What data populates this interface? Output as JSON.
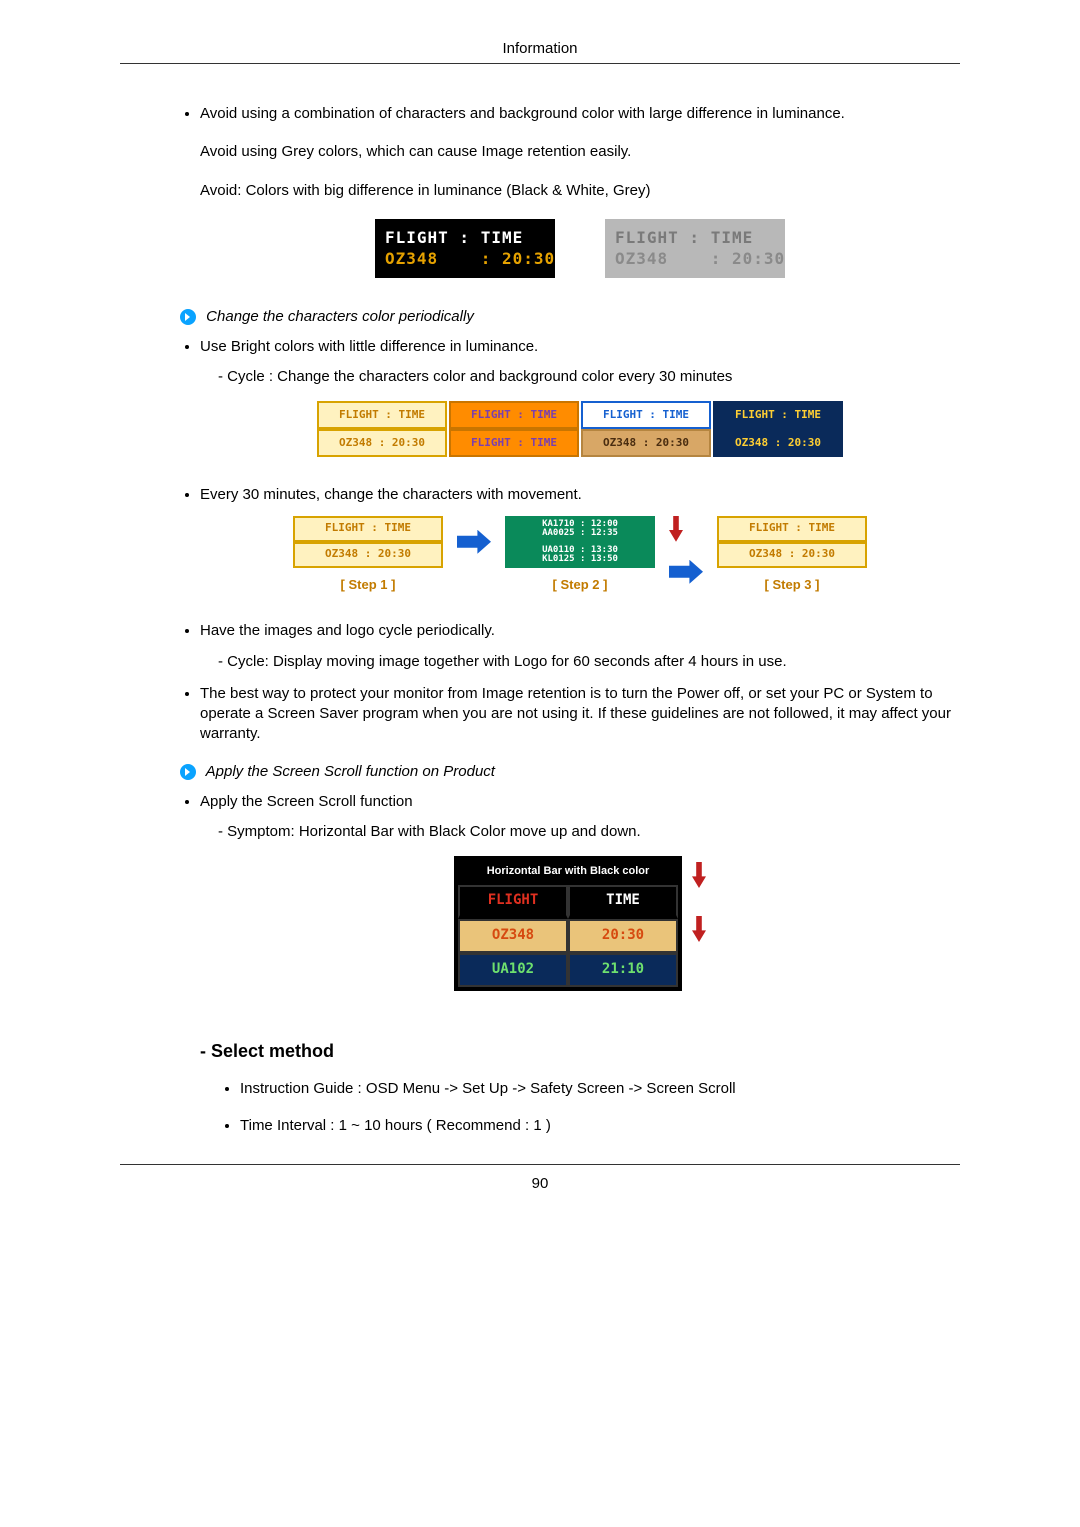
{
  "header": {
    "title": "Information"
  },
  "body": {
    "p1": "Avoid using a combination of characters and background color with large difference in luminance.",
    "p2": "Avoid using Grey colors, which can cause Image retention easily.",
    "p3": "Avoid: Colors with big difference in luminance (Black & White, Grey)",
    "flight_sample": {
      "row1": "FLIGHT : TIME",
      "row2": "OZ348    : 20:30"
    },
    "sec1_title": "Change the characters color periodically",
    "li_bright": "Use Bright colors with little difference in luminance.",
    "li_bright_sub": "- Cycle : Change the characters color and background color every 30 minutes",
    "cycle_cells": {
      "a": "FLIGHT : TIME",
      "b": "OZ348    : 20:30",
      "c": "FLIGHT : TIME",
      "d": "FLIGHT : TIME",
      "e": "OZ348    : 20:30",
      "f": "OZ348    : 20:30"
    },
    "li_move": "Every 30 minutes, change the characters with movement.",
    "steps": {
      "s1": "[ Step 1 ]",
      "s2": "[ Step 2 ]",
      "s3": "[ Step 3 ]",
      "green_a": "KA1710 : 12:00",
      "green_b": "AA0025 : 12:35",
      "green_c": "UA0110 : 13:30",
      "green_d": "KL0125 : 13:50"
    },
    "li_logo": "Have the images and logo cycle periodically.",
    "li_logo_sub": "- Cycle: Display moving image together with Logo for 60 seconds after 4 hours in use.",
    "li_best": "The best way to protect your monitor from Image retention is to turn the Power off, or set your PC or System to operate a Screen Saver program when you are not using it. If these guidelines are not followed, it may affect your warranty.",
    "sec2_title": "Apply the Screen Scroll function on Product",
    "li_apply": "Apply the Screen Scroll function",
    "li_apply_sub": "- Symptom: Horizontal Bar with Black Color move up and down.",
    "scroll_table": {
      "caption": "Horizontal Bar with Black color",
      "r1a": "FLIGHT",
      "r1b": "TIME",
      "r2a": "OZ348",
      "r2b": "20:30",
      "r3a": "UA102",
      "r3b": "21:10"
    },
    "select_method": "- Select method",
    "sub1": "Instruction Guide : OSD Menu -> Set Up -> Safety Screen -> Screen Scroll",
    "sub2": "Time Interval : 1 ~ 10 hours ( Recommend : 1 )"
  },
  "footer": {
    "page_number": "90"
  }
}
